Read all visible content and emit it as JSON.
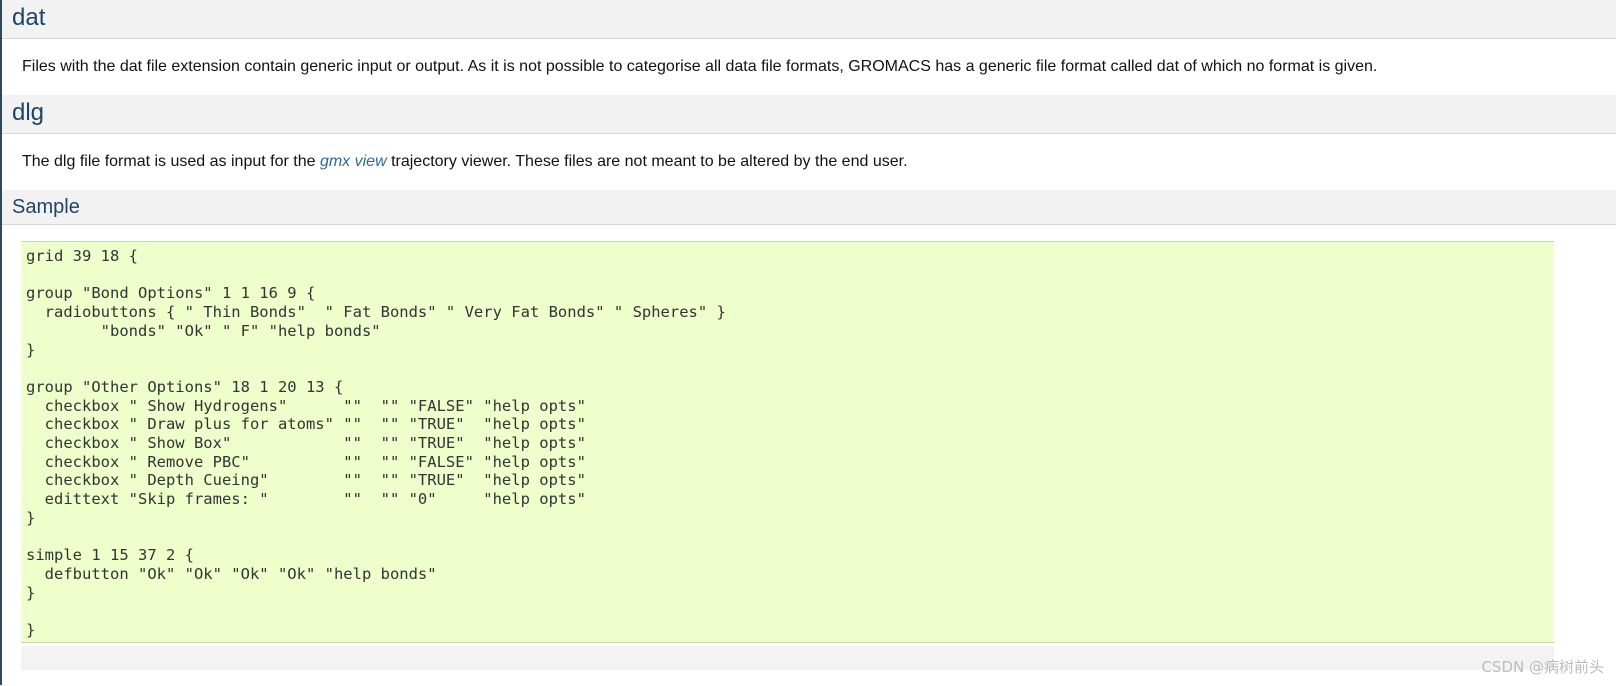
{
  "sections": {
    "dat": {
      "heading": "dat",
      "description": "Files with the dat file extension contain generic input or output. As it is not possible to categorise all data file formats, GROMACS has a generic file format called dat of which no format is given."
    },
    "dlg": {
      "heading": "dlg",
      "description_before": "The dlg file format is used as input for the ",
      "link_text": "gmx view",
      "description_after": " trajectory viewer. These files are not meant to be altered by the end user."
    },
    "sample": {
      "heading": "Sample",
      "code": "grid 39 18 {\n\ngroup \"Bond Options\" 1 1 16 9 {\n  radiobuttons { \" Thin Bonds\"  \" Fat Bonds\" \" Very Fat Bonds\" \" Spheres\" }\n        \"bonds\" \"Ok\" \" F\" \"help bonds\"\n}\n\ngroup \"Other Options\" 18 1 20 13 {\n  checkbox \" Show Hydrogens\"      \"\"  \"\" \"FALSE\" \"help opts\"\n  checkbox \" Draw plus for atoms\" \"\"  \"\" \"TRUE\"  \"help opts\"\n  checkbox \" Show Box\"            \"\"  \"\" \"TRUE\"  \"help opts\"\n  checkbox \" Remove PBC\"          \"\"  \"\" \"FALSE\" \"help opts\"\n  checkbox \" Depth Cueing\"        \"\"  \"\" \"TRUE\"  \"help opts\"\n  edittext \"Skip frames: \"        \"\"  \"\" \"0\"     \"help opts\"\n}\n\nsimple 1 15 37 2 {\n  defbutton \"Ok\" \"Ok\" \"Ok\" \"Ok\" \"help bonds\"\n}\n\n}"
    }
  },
  "watermark": "CSDN @病树前头",
  "colors": {
    "heading": "#1d4568",
    "link": "#2e6a9b",
    "code_background": "#eeffcc",
    "heading_bar": "#f2f2f2",
    "left_rule": "#2b4a5d"
  }
}
